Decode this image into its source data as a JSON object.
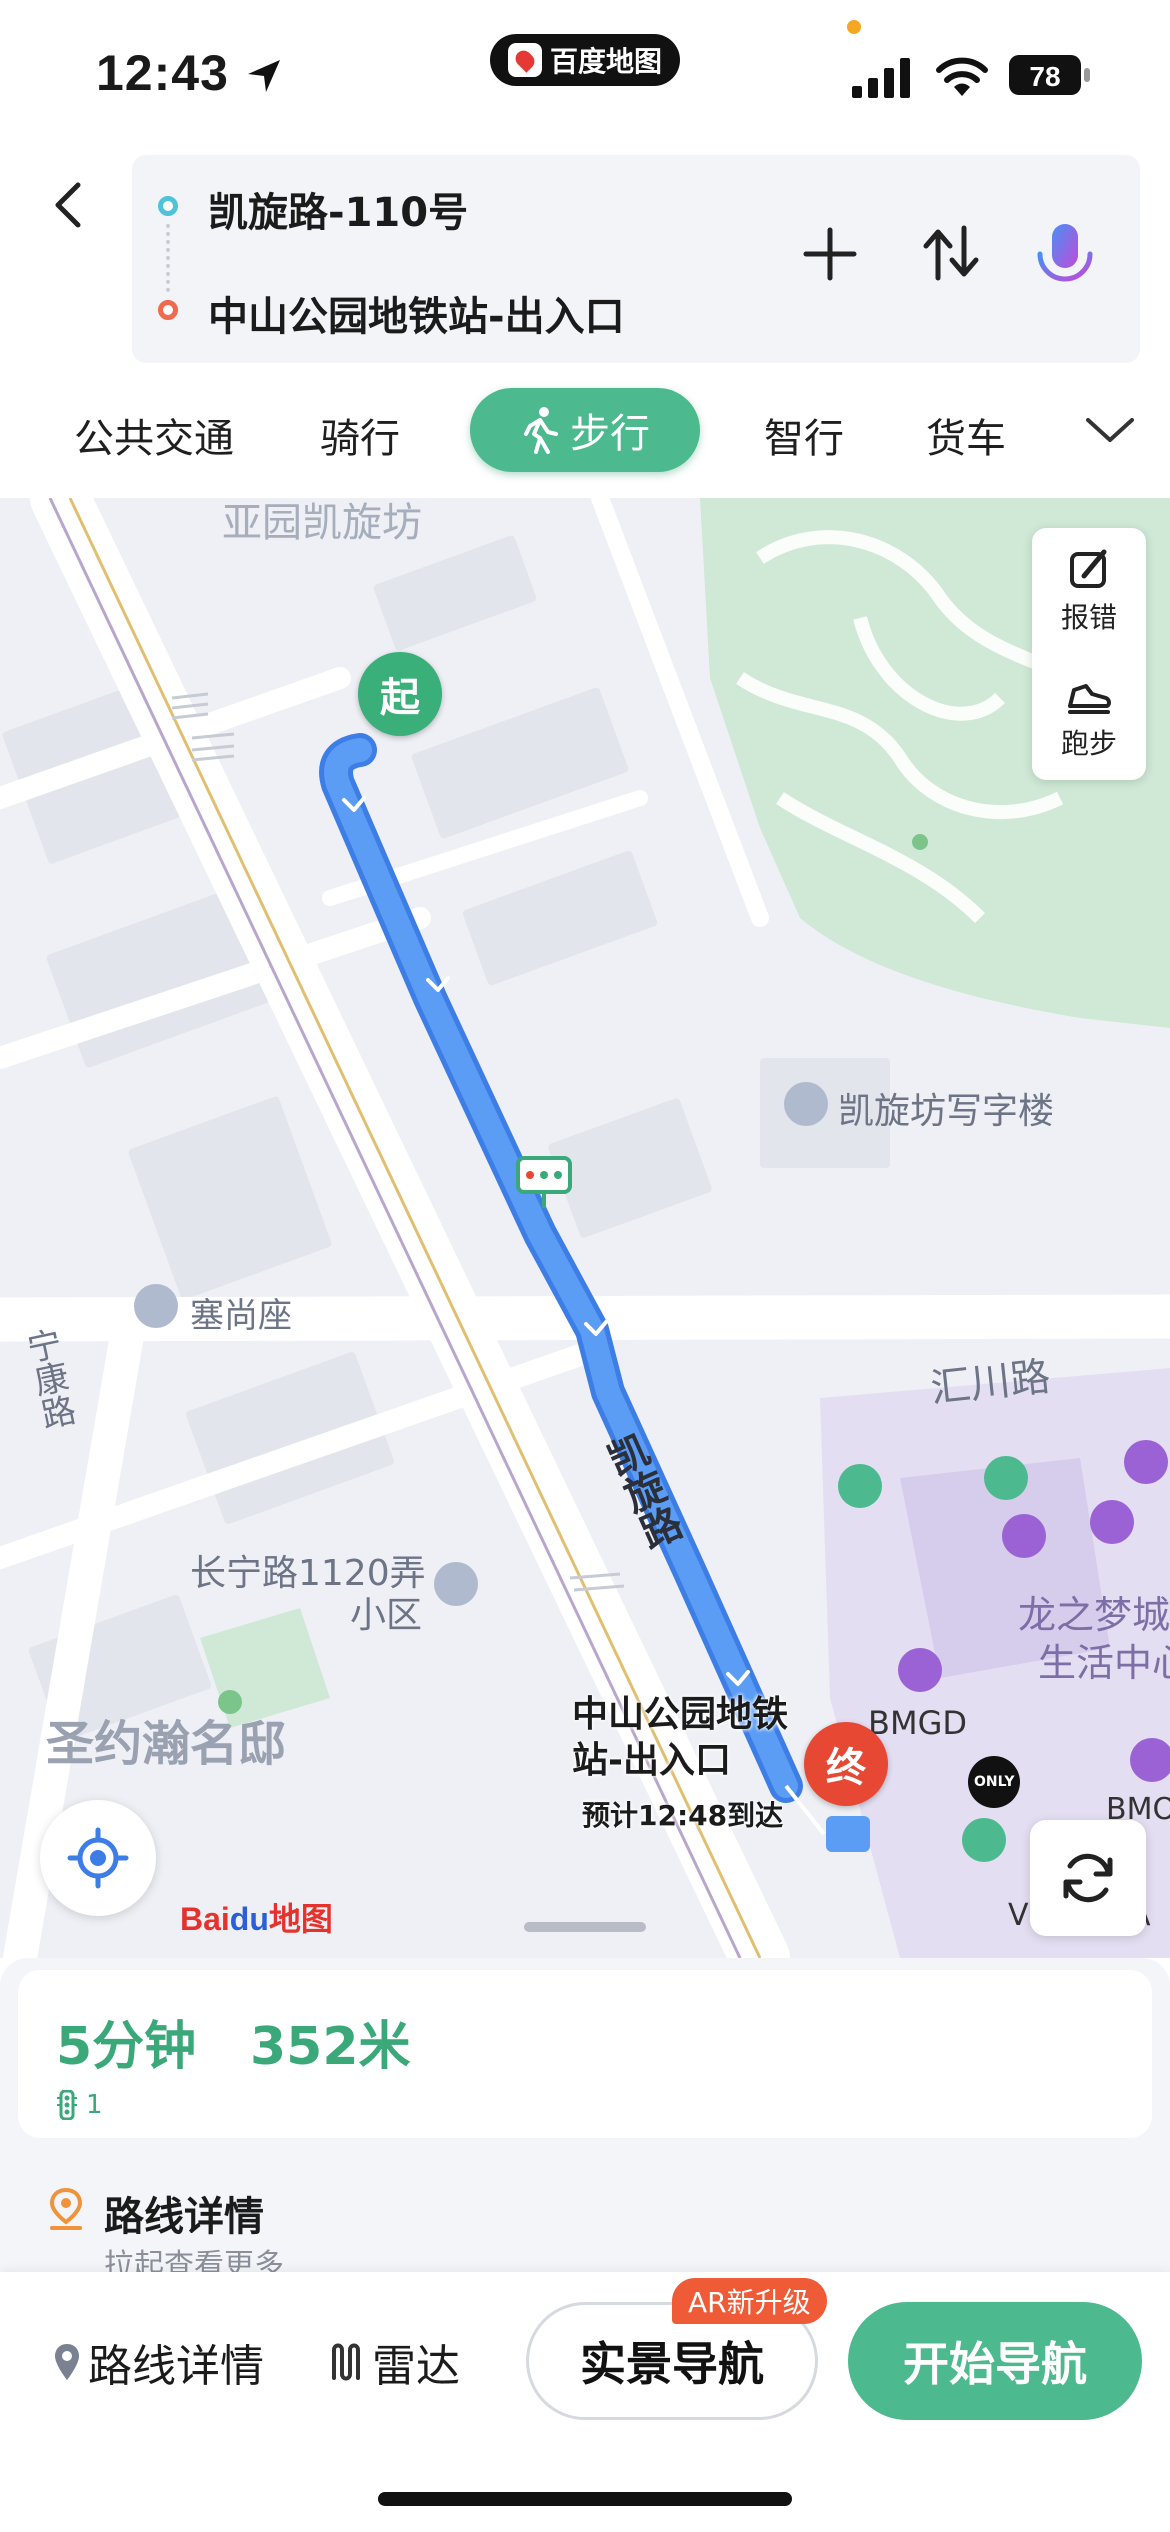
{
  "status_bar": {
    "time": "12:43",
    "app_name": "百度地图",
    "battery": "78"
  },
  "route": {
    "from": "凯旋路-110号",
    "to": "中山公园地铁站-出入口"
  },
  "modes": [
    "公共交通",
    "骑行",
    "步行",
    "智行",
    "货车"
  ],
  "active_mode": "步行",
  "map": {
    "labels": {
      "top_partial": "亚园凯旋坊",
      "office": "凯旋坊写字楼",
      "saishang": "塞尚座",
      "ningkang": "宁康路",
      "changning": "长宁路1120弄",
      "changning2": "小区",
      "shengyue": "圣约瀚名邸",
      "huichuan": "汇川路",
      "kaixuan_road": "凯旋路",
      "longzhimeng1": "龙之梦城",
      "longzhimeng2": "生活中心",
      "bmgd": "BMGD",
      "only": "ONLY",
      "bmo": "BMO",
      "victoria": "VICTORIA"
    },
    "start_marker": "起",
    "end_marker": "终",
    "destination_line1": "中山公园地铁",
    "destination_line2": "站-出入口",
    "eta": "预计12:48到达",
    "tools": {
      "report": "报错",
      "run": "跑步"
    },
    "logo_bai": "Bai",
    "logo_du": "du",
    "logo_map": "地图"
  },
  "summary": {
    "duration": "5分钟",
    "distance": "352米",
    "traffic_lights": "1",
    "detail_title": "路线详情",
    "detail_sub": "拉起查看更多"
  },
  "bottom_bar": {
    "route_detail": "路线详情",
    "radar": "雷达",
    "ar_nav": "实景导航",
    "ar_badge": "AR新升级",
    "start_nav": "开始导航"
  },
  "colors": {
    "accent_green": "#4cb98e",
    "route_blue": "#4a8ef0",
    "end_red": "#e64833",
    "park_green": "#cfe9d6"
  }
}
